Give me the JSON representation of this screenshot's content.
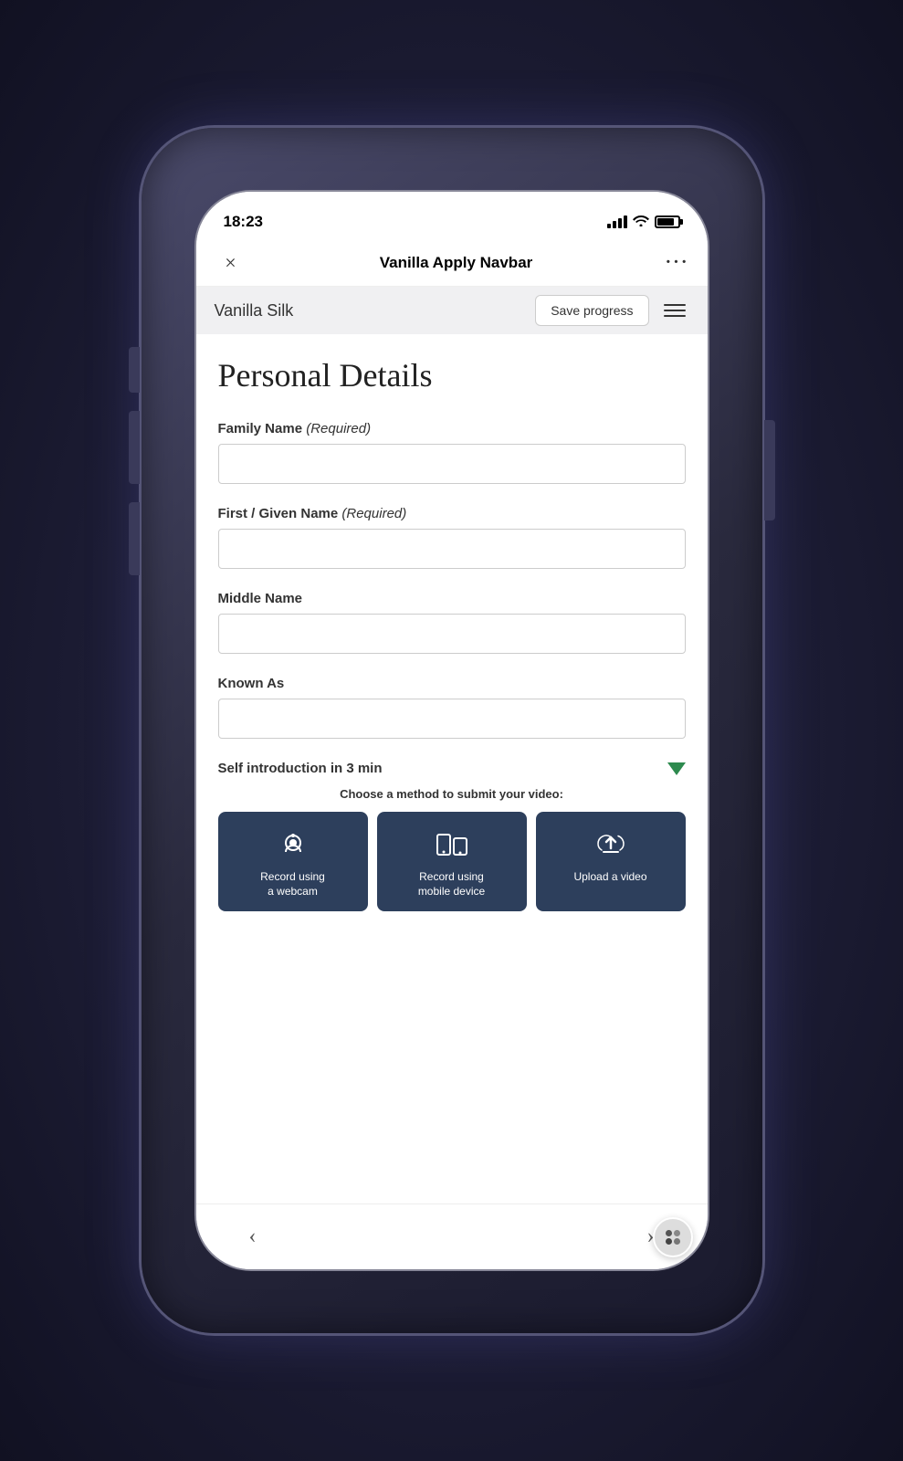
{
  "device": {
    "time": "18:23",
    "battery_percent": 85
  },
  "navbar": {
    "title": "Vanilla Apply Navbar",
    "close_label": "×",
    "more_label": "···"
  },
  "sub_header": {
    "brand": "Vanilla Silk",
    "save_progress_label": "Save progress"
  },
  "form": {
    "page_title": "Personal Details",
    "fields": [
      {
        "id": "family-name",
        "label": "Family Name",
        "required": true,
        "required_text": "(Required)",
        "value": "",
        "placeholder": ""
      },
      {
        "id": "given-name",
        "label": "First / Given Name",
        "required": true,
        "required_text": "(Required)",
        "value": "",
        "placeholder": ""
      },
      {
        "id": "middle-name",
        "label": "Middle Name",
        "required": false,
        "required_text": "",
        "value": "",
        "placeholder": ""
      },
      {
        "id": "known-as",
        "label": "Known As",
        "required": false,
        "required_text": "",
        "value": "",
        "placeholder": ""
      }
    ],
    "video_section": {
      "label": "Self introduction in 3 min",
      "method_prompt": "Choose a method to submit your video:",
      "options": [
        {
          "id": "webcam",
          "label": "Record using\na webcam",
          "icon": "webcam"
        },
        {
          "id": "mobile",
          "label": "Record using\nmobile device",
          "icon": "mobile"
        },
        {
          "id": "upload",
          "label": "Upload a video",
          "icon": "upload"
        }
      ]
    }
  },
  "bottom_nav": {
    "back_label": "‹",
    "forward_label": "›"
  },
  "colors": {
    "dark_blue": "#2d3f5c",
    "green_arrow": "#2d8a4e",
    "brand_bg": "#f0f0f2"
  }
}
